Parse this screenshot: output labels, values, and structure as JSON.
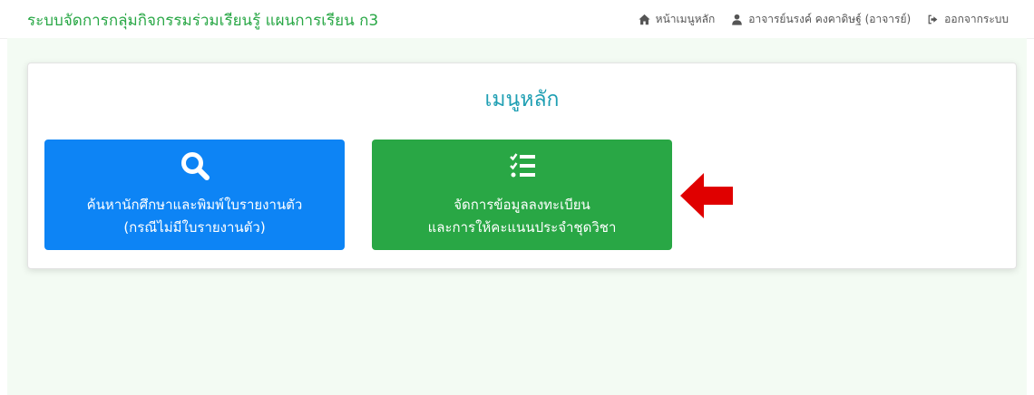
{
  "navbar": {
    "brand": "ระบบจัดการกลุ่มกิจกรรมร่วมเรียนรู้ แผนการเรียน ก3",
    "home_label": "หน้าเมนูหลัก",
    "user_label": "อาจารย์นรงค์ คงคาดิษฐ์ (อาจารย์)",
    "logout_label": "ออกจากระบบ"
  },
  "main": {
    "title": "เมนูหลัก",
    "buttons": [
      {
        "line1": "ค้นหานักศึกษาและพิมพ์ใบรายงานตัว",
        "line2": "(กรณีไม่มีใบรายงานตัว)",
        "icon": "search-icon",
        "color": "#0d84f5"
      },
      {
        "line1": "จัดการข้อมูลลงทะเบียน",
        "line2": "และการให้คะแนนประจำชุดวิชา",
        "icon": "list-check-icon",
        "color": "#29a745"
      }
    ]
  },
  "colors": {
    "brand": "#28a745",
    "title": "#1f9fb3",
    "arrow": "#e00000",
    "background": "#f3fbf3"
  }
}
